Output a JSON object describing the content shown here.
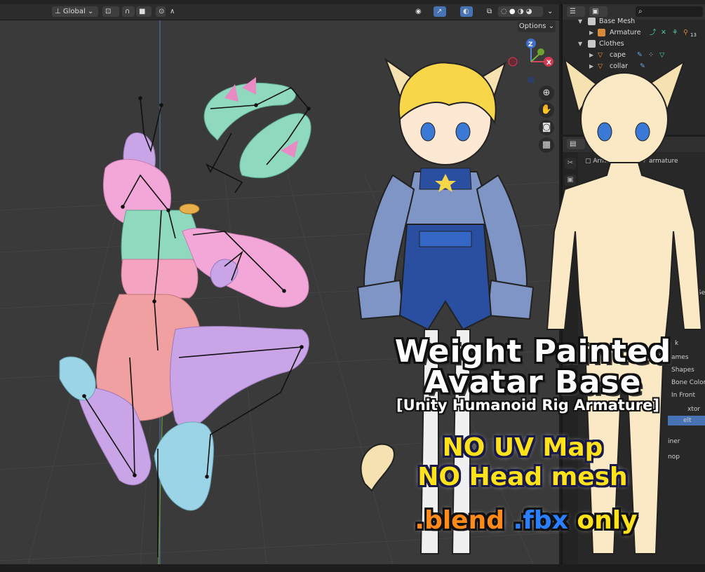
{
  "header": {
    "transform_orientation": "Global",
    "chevron": "⌄"
  },
  "viewport": {
    "options_label": "Options",
    "gizmo_z": "Z",
    "gizmo_x": "X"
  },
  "outliner": {
    "rows": [
      {
        "label": "Base Mesh",
        "indent": 0
      },
      {
        "label": "Armature",
        "indent": 1
      },
      {
        "label": "Clothes",
        "indent": 0
      },
      {
        "label": "cape",
        "indent": 1
      },
      {
        "label": "collar",
        "indent": 1
      }
    ],
    "count_badge": "13"
  },
  "properties": {
    "object_name": "Armat",
    "data_name": "armature",
    "partial_labels": [
      "B",
      "e",
      "k",
      "ames",
      "Shapes",
      "Bone Colors",
      "In Front",
      "xtor",
      "elt",
      "iner",
      "nop"
    ]
  },
  "promo": {
    "title_line1": "Weight Painted",
    "title_line2": "Avatar Base",
    "subtitle": "[Unity Humanoid Rig Armature]",
    "no_uv": "NO UV Map",
    "no_head": "NO Head mesh",
    "format_blend": ".blend",
    "format_fbx": ".fbx",
    "format_only": "only"
  },
  "colors": {
    "blend_orange": "#ff8a1a",
    "fbx_blue": "#2a7fff",
    "only_yellow": "#ffe21a",
    "accent_blue": "#4772b3"
  }
}
